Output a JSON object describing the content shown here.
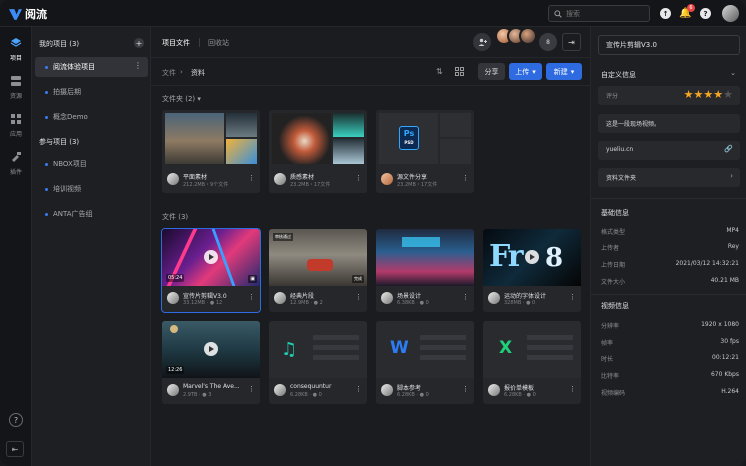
{
  "app": {
    "name": "阅流"
  },
  "search": {
    "placeholder": "搜索"
  },
  "notifications": {
    "count": "6"
  },
  "rail": [
    {
      "label": "项目",
      "icon": "layers-icon"
    },
    {
      "label": "资源",
      "icon": "server-icon"
    },
    {
      "label": "应用",
      "icon": "apps-grid-icon"
    },
    {
      "label": "插件",
      "icon": "plugin-icon"
    }
  ],
  "projects": {
    "my_header": "我的项目 (3)",
    "my": [
      "阅流体验项目",
      "拍摄后期",
      "概念Demo"
    ],
    "joined_header": "参与项目 (3)",
    "joined": [
      "NBOX项目",
      "培训视频",
      "ANTA广告组"
    ]
  },
  "tabs": {
    "files": "项目文件",
    "recycle": "回收站"
  },
  "members": {
    "more_count": "8"
  },
  "breadcrumb": {
    "root": "文件",
    "current": "资料"
  },
  "toolbar": {
    "share": "分享",
    "upload": "上传",
    "new": "新建"
  },
  "folders": {
    "label": "文件夹 (2)",
    "items": [
      {
        "name": "平面素材",
        "meta": "212.2MB・9个文件"
      },
      {
        "name": "质感素材",
        "meta": "23.2MB・17文件"
      },
      {
        "name": "源文件分享",
        "meta": "23.2MB・17文件"
      }
    ]
  },
  "files": {
    "label": "文件 (3)",
    "items": [
      {
        "name": "宣传片剪辑V3.0",
        "size": "33.12MB",
        "comments": "12",
        "duration": "05:24",
        "tag": ""
      },
      {
        "name": "经典片段",
        "size": "12.9MB",
        "comments": "2",
        "duration": "",
        "tag": "完成"
      },
      {
        "name": "场景设计",
        "size": "6.38KB",
        "comments": "0",
        "duration": "",
        "tag": ""
      },
      {
        "name": "运动的字体设计",
        "size": "328MB",
        "comments": "0",
        "duration": "",
        "tag": ""
      },
      {
        "name": "Marvel's The Ave...",
        "size": "2.9TB",
        "comments": "3",
        "duration": "12:26",
        "tag": ""
      },
      {
        "name": "consequuntur",
        "size": "6.28KB",
        "comments": "0",
        "duration": "",
        "tag": ""
      },
      {
        "name": "脚本参考",
        "size": "6.28KB",
        "comments": "0",
        "duration": "",
        "tag": ""
      },
      {
        "name": "报价单模板",
        "size": "6.28KB",
        "comments": "0",
        "duration": "",
        "tag": ""
      }
    ],
    "pending_tag": "审核通过"
  },
  "detail": {
    "title": "宣传片剪辑V3.0",
    "custom_label": "自定义信息",
    "rating_label": "评分",
    "rating": 4,
    "description": "这是一段现场视频。",
    "link": "yueliu.cn",
    "folder_link": "资料文件夹",
    "basic_label": "基础信息",
    "basic": [
      {
        "k": "格式类型",
        "v": "MP4"
      },
      {
        "k": "上传者",
        "v": "Rey"
      },
      {
        "k": "上传日期",
        "v": "2021/03/12 14:32:21"
      },
      {
        "k": "文件大小",
        "v": "40.21 MB"
      }
    ],
    "video_label": "视频信息",
    "video": [
      {
        "k": "分辨率",
        "v": "1920 x 1080"
      },
      {
        "k": "帧率",
        "v": "30 fps"
      },
      {
        "k": "时长",
        "v": "00:12:21"
      },
      {
        "k": "比特率",
        "v": "670 Kbps"
      },
      {
        "k": "视频编码",
        "v": "H.264"
      }
    ]
  }
}
